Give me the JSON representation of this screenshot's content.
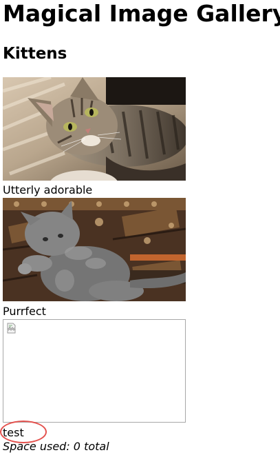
{
  "page": {
    "title": "Magical Image Gallery",
    "section_title": "Kittens"
  },
  "gallery": {
    "items": [
      {
        "caption": "Utterly adorable",
        "image": "tabby-kitten-lying-photo"
      },
      {
        "caption": "Purrfect",
        "image": "grey-kitten-playing-photo"
      },
      {
        "caption": "test",
        "image": "broken-image-icon"
      }
    ]
  },
  "storage": {
    "space_used": "Space used: 0 total"
  },
  "annotation": {
    "highlight_color": "#e4524e"
  }
}
